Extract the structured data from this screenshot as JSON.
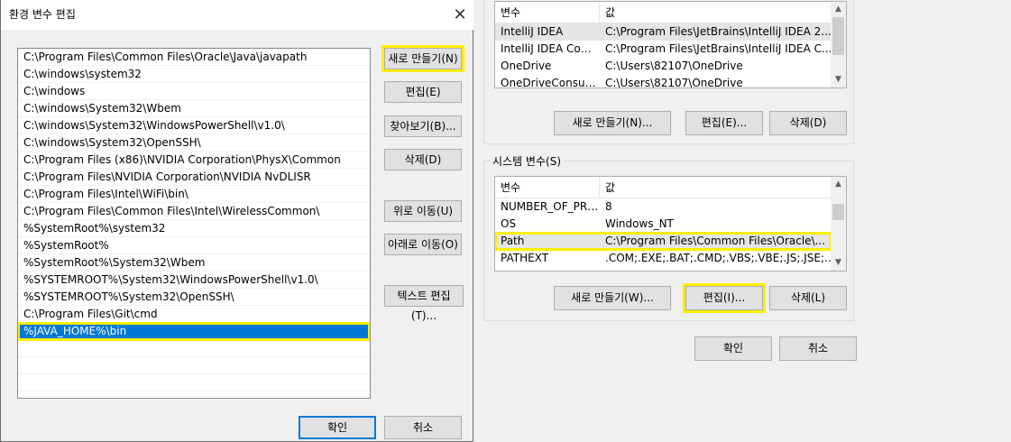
{
  "env_vars_dialog": {
    "user_vars": {
      "header": {
        "col_var": "변수",
        "col_value": "값"
      },
      "rows": [
        {
          "name": "IntelliJ IDEA",
          "value": "C:\\Program Files\\JetBrains\\IntelliJ IDEA 2..."
        },
        {
          "name": "IntelliJ IDEA Com...",
          "value": "C:\\Program Files\\JetBrains\\IntelliJ IDEA C..."
        },
        {
          "name": "OneDrive",
          "value": "C:\\Users\\82107\\OneDrive"
        },
        {
          "name": "OneDriveConsumer",
          "value": "C:\\Users\\82107\\OneDrive"
        }
      ],
      "buttons": {
        "new": "새로 만들기(N)...",
        "edit": "편집(E)...",
        "delete": "삭제(D)"
      }
    },
    "system_vars": {
      "label": "시스템 변수(S)",
      "header": {
        "col_var": "변수",
        "col_value": "값"
      },
      "rows": [
        {
          "name": "NUMBER_OF_PRO...",
          "value": "8"
        },
        {
          "name": "OS",
          "value": "Windows_NT"
        },
        {
          "name": "Path",
          "value": "C:\\Program Files\\Common Files\\Oracle\\..."
        },
        {
          "name": "PATHEXT",
          "value": ".COM;.EXE;.BAT;.CMD;.VBS;.VBE;.JS;.JSE;.W..."
        }
      ],
      "buttons": {
        "new": "새로 만들기(W)...",
        "edit": "편집(I)...",
        "delete": "삭제(L)"
      }
    },
    "ok": "확인",
    "cancel": "취소"
  },
  "edit_dialog": {
    "title": "환경 변수 편집",
    "close_glyph": "✕",
    "paths": [
      "C:\\Program Files\\Common Files\\Oracle\\Java\\javapath",
      "C:\\windows\\system32",
      "C:\\windows",
      "C:\\windows\\System32\\Wbem",
      "C:\\windows\\System32\\WindowsPowerShell\\v1.0\\",
      "C:\\windows\\System32\\OpenSSH\\",
      "C:\\Program Files (x86)\\NVIDIA Corporation\\PhysX\\Common",
      "C:\\Program Files\\NVIDIA Corporation\\NVIDIA NvDLISR",
      "C:\\Program Files\\Intel\\WiFi\\bin\\",
      "C:\\Program Files\\Common Files\\Intel\\WirelessCommon\\",
      "%SystemRoot%\\system32",
      "%SystemRoot%",
      "%SystemRoot%\\System32\\Wbem",
      "%SYSTEMROOT%\\System32\\WindowsPowerShell\\v1.0\\",
      "%SYSTEMROOT%\\System32\\OpenSSH\\",
      "C:\\Program Files\\Git\\cmd",
      "%JAVA_HOME%\\bin"
    ],
    "selected_index": 16,
    "buttons": {
      "new": "새로 만들기(N)",
      "edit": "편집(E)",
      "browse": "찾아보기(B)...",
      "delete": "삭제(D)",
      "move_up": "위로 이동(U)",
      "move_down": "아래로 이동(O)",
      "edit_text": "텍스트 편집(T)..."
    },
    "ok": "확인",
    "cancel": "취소"
  },
  "colors": {
    "highlight": "#ffee00",
    "selection": "#0078d7"
  }
}
